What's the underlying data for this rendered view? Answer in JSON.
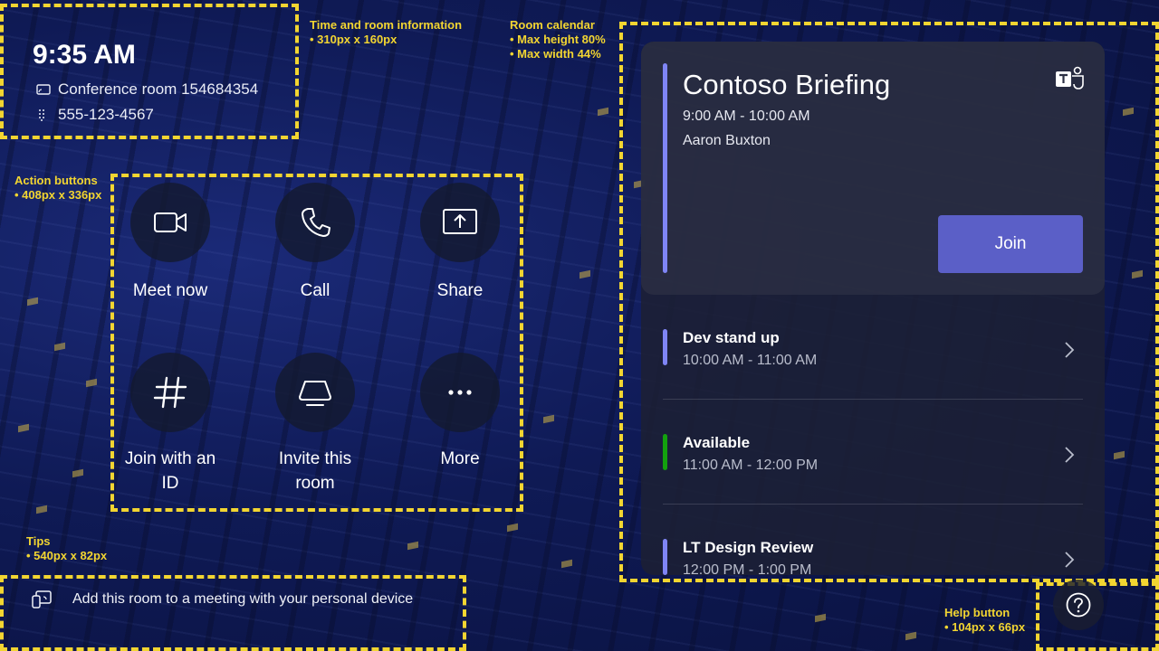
{
  "status": {
    "time": "9:35 AM",
    "room_name": "Conference room 154684354",
    "phone": "555-123-4567"
  },
  "actions": [
    {
      "label": "Meet now",
      "icon": "video-camera-icon"
    },
    {
      "label": "Call",
      "icon": "phone-icon"
    },
    {
      "label": "Share",
      "icon": "share-screen-icon"
    },
    {
      "label": "Join with an ID",
      "icon": "hashtag-icon"
    },
    {
      "label": "Invite this room",
      "icon": "room-device-icon"
    },
    {
      "label": "More",
      "icon": "more-icon"
    }
  ],
  "calendar": {
    "current": {
      "title": "Contoso Briefing",
      "time": "9:00 AM - 10:00 AM",
      "organizer": "Aaron Buxton",
      "join_label": "Join",
      "accent": "#7f85f5"
    },
    "upcoming": [
      {
        "name": "Dev stand up",
        "time": "10:00 AM - 11:00 AM",
        "accent": "#7f85f5"
      },
      {
        "name": "Available",
        "time": "11:00 AM - 12:00 PM",
        "accent": "#13a10e"
      },
      {
        "name": "LT Design Review",
        "time": "12:00 PM - 1:00 PM",
        "accent": "#7f85f5"
      }
    ]
  },
  "tip": {
    "text": "Add this room to a meeting with your personal device",
    "icon": "cast-device-icon"
  },
  "help": {
    "icon": "help-icon"
  },
  "annotations": {
    "time_room": {
      "title": "Time and room information",
      "spec": "• 310px x 160px"
    },
    "calendar": {
      "title": "Room calendar",
      "spec1": "• Max height 80%",
      "spec2": "• Max width 44%"
    },
    "actions": {
      "title": "Action buttons",
      "spec": "• 408px x 336px"
    },
    "tips": {
      "title": "Tips",
      "spec": "• 540px x 82px"
    },
    "help": {
      "title": "Help button",
      "spec": "• 104px x 66px"
    }
  },
  "colors": {
    "guide": "#f2d531",
    "join_button": "#5b5fc7",
    "available": "#13a10e",
    "meeting_accent": "#7f85f5"
  }
}
